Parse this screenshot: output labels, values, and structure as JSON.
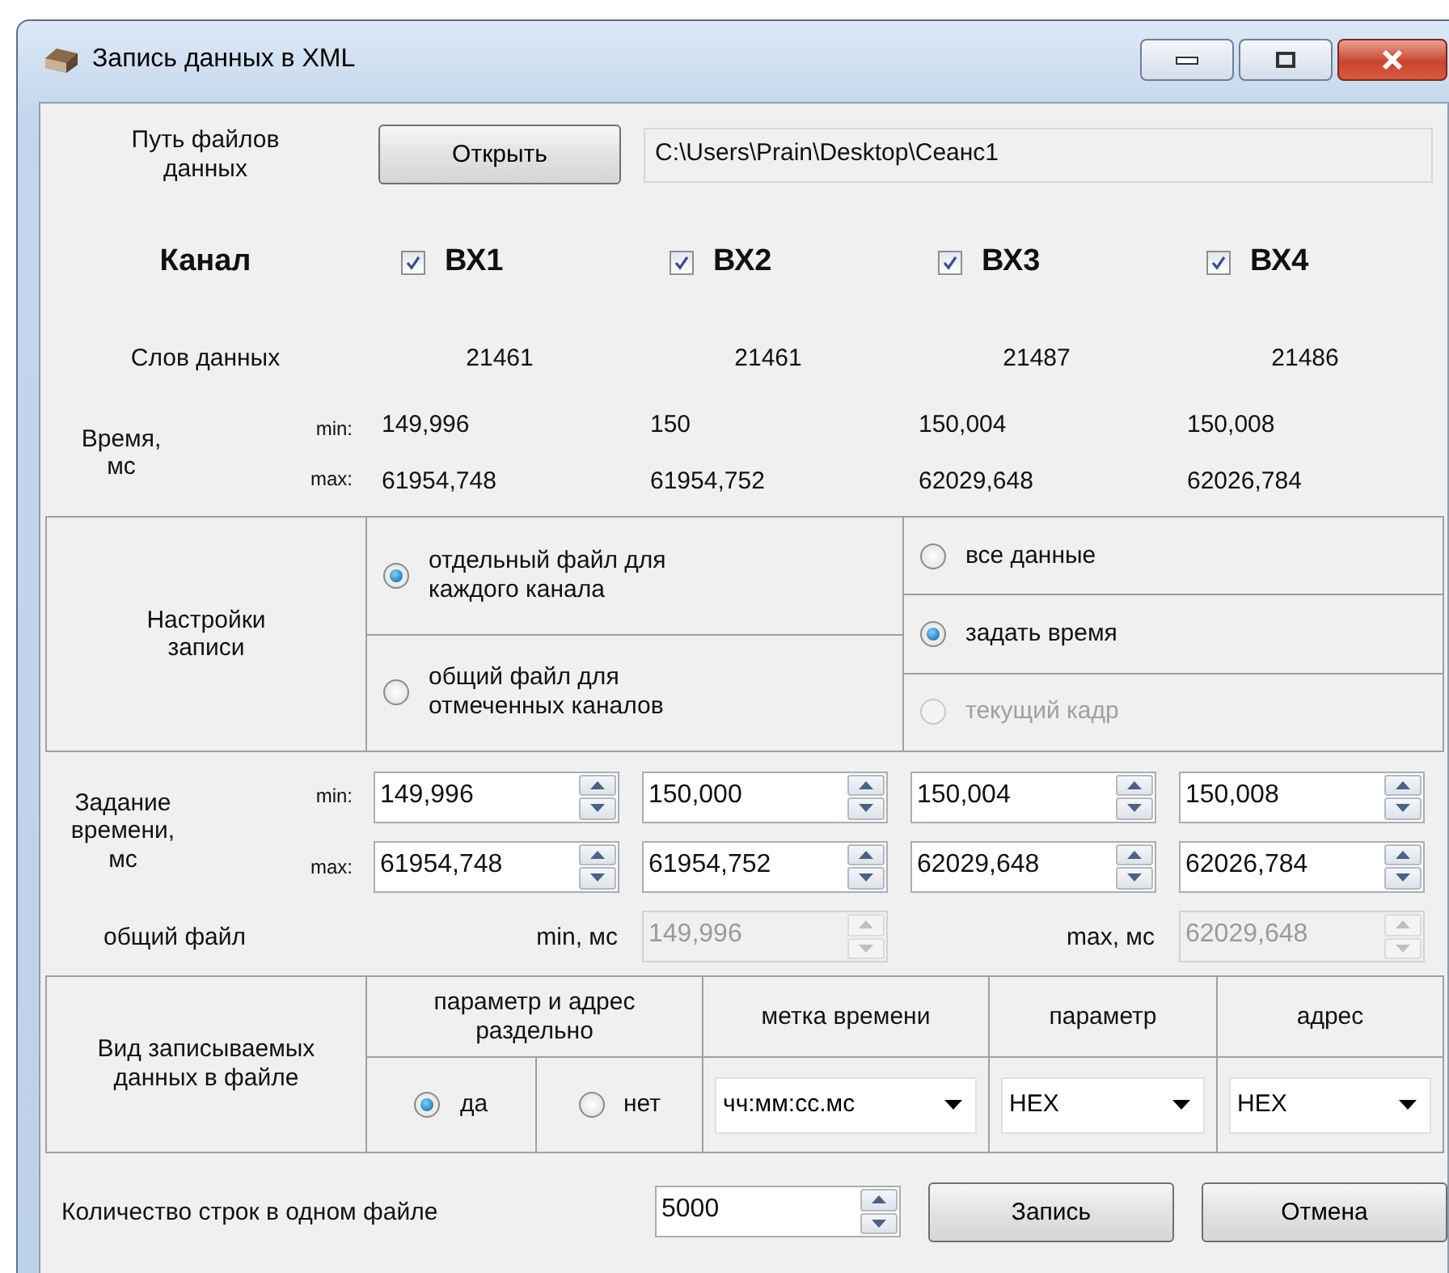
{
  "window": {
    "title": "Запись данных в XML"
  },
  "path": {
    "label": "Путь файлов данных",
    "button": "Открыть",
    "value": "C:\\Users\\Prain\\Desktop\\Сеанс1"
  },
  "channels_header": "Канал",
  "channels": [
    {
      "name": "ВХ1",
      "checked": true,
      "words": "21461",
      "min": "149,996",
      "max": "61954,748"
    },
    {
      "name": "ВХ2",
      "checked": true,
      "words": "21461",
      "min": "150",
      "max": "61954,752"
    },
    {
      "name": "ВХ3",
      "checked": true,
      "words": "21487",
      "min": "150,004",
      "max": "62029,648"
    },
    {
      "name": "ВХ4",
      "checked": true,
      "words": "21486",
      "min": "150,008",
      "max": "62026,784"
    }
  ],
  "words_label": "Слов данных",
  "time": {
    "label": "Время, мс",
    "min_label": "min:",
    "max_label": "max:"
  },
  "settings": {
    "label": "Настройки записи",
    "file_options": [
      {
        "label": "отдельный файл для каждого канала",
        "selected": true
      },
      {
        "label": "общий файл для отмеченных каналов",
        "selected": false
      }
    ],
    "range_options": [
      {
        "label": "все данные",
        "selected": false,
        "disabled": false
      },
      {
        "label": "задать время",
        "selected": true,
        "disabled": false
      },
      {
        "label": "текущий кадр",
        "selected": false,
        "disabled": true
      }
    ]
  },
  "time_setting": {
    "label": "Задание времени, мс",
    "min_label": "min:",
    "max_label": "max:",
    "channels": [
      {
        "min": "149,996",
        "max": "61954,748"
      },
      {
        "min": "150,000",
        "max": "61954,752"
      },
      {
        "min": "150,004",
        "max": "62029,648"
      },
      {
        "min": "150,008",
        "max": "62026,784"
      }
    ]
  },
  "common_file": {
    "label": "общий файл",
    "min_label": "min, мс",
    "min": "149,996",
    "max_label": "max, мс",
    "max": "62029,648",
    "disabled": true
  },
  "format": {
    "label": "Вид записываемых данных в файле",
    "separate": {
      "header": "параметр и адрес раздельно",
      "options": [
        {
          "label": "да",
          "selected": true
        },
        {
          "label": "нет",
          "selected": false
        }
      ]
    },
    "dropdowns": [
      {
        "header": "метка времени",
        "value": "чч:мм:сс.мс"
      },
      {
        "header": "параметр",
        "value": "HEX"
      },
      {
        "header": "адрес",
        "value": "HEX"
      }
    ]
  },
  "rows_per_file": {
    "label": "Количество строк в одном файле",
    "value": "5000"
  },
  "buttons": [
    "Запись",
    "Отмена"
  ]
}
